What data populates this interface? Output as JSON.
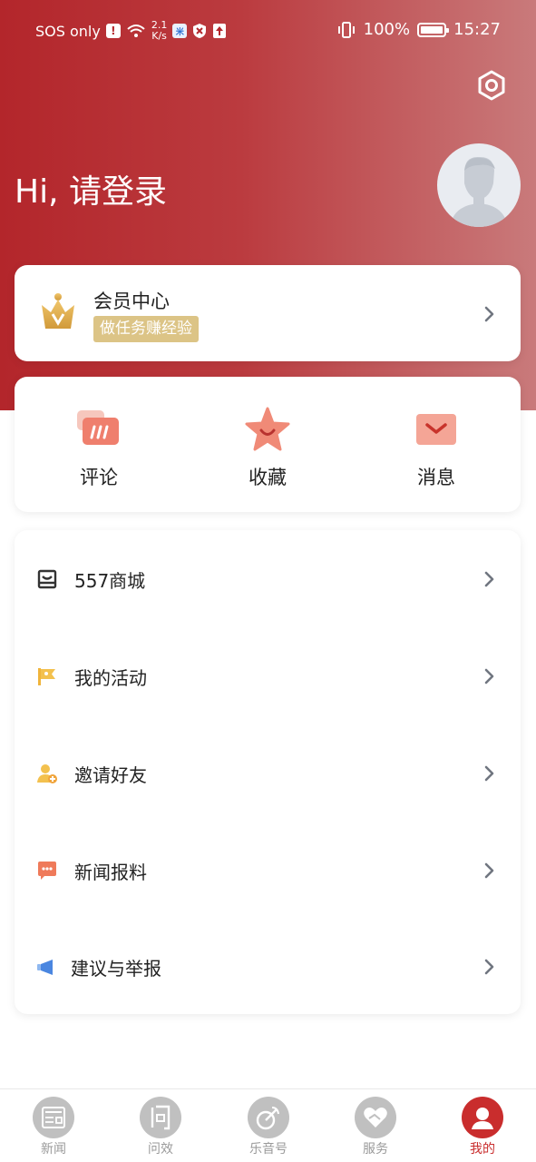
{
  "status_bar": {
    "carrier": "SOS only",
    "net_speed_value": "2.1",
    "net_speed_unit": "K/s",
    "battery": "100%",
    "time": "15:27"
  },
  "header": {
    "greeting": "Hi, 请登录"
  },
  "member": {
    "title": "会员中心",
    "badge": "做任务赚经验"
  },
  "quick_actions": [
    {
      "label": "评论",
      "icon": "comment-icon"
    },
    {
      "label": "收藏",
      "icon": "star-icon"
    },
    {
      "label": "消息",
      "icon": "mail-icon"
    }
  ],
  "menu": [
    {
      "label": "557商城",
      "icon": "shop-icon"
    },
    {
      "label": "我的活动",
      "icon": "flag-icon"
    },
    {
      "label": "邀请好友",
      "icon": "invite-user-icon"
    },
    {
      "label": "新闻报料",
      "icon": "chat-report-icon"
    },
    {
      "label": "建议与举报",
      "icon": "megaphone-icon"
    }
  ],
  "tabbar": [
    {
      "label": "新闻",
      "active": false
    },
    {
      "label": "问效",
      "active": false
    },
    {
      "label": "乐音号",
      "active": false
    },
    {
      "label": "服务",
      "active": false
    },
    {
      "label": "我的",
      "active": true
    }
  ],
  "colors": {
    "brand_red": "#b3262b",
    "active_tab": "#c92d2d",
    "badge_gold": "#dcc486"
  }
}
